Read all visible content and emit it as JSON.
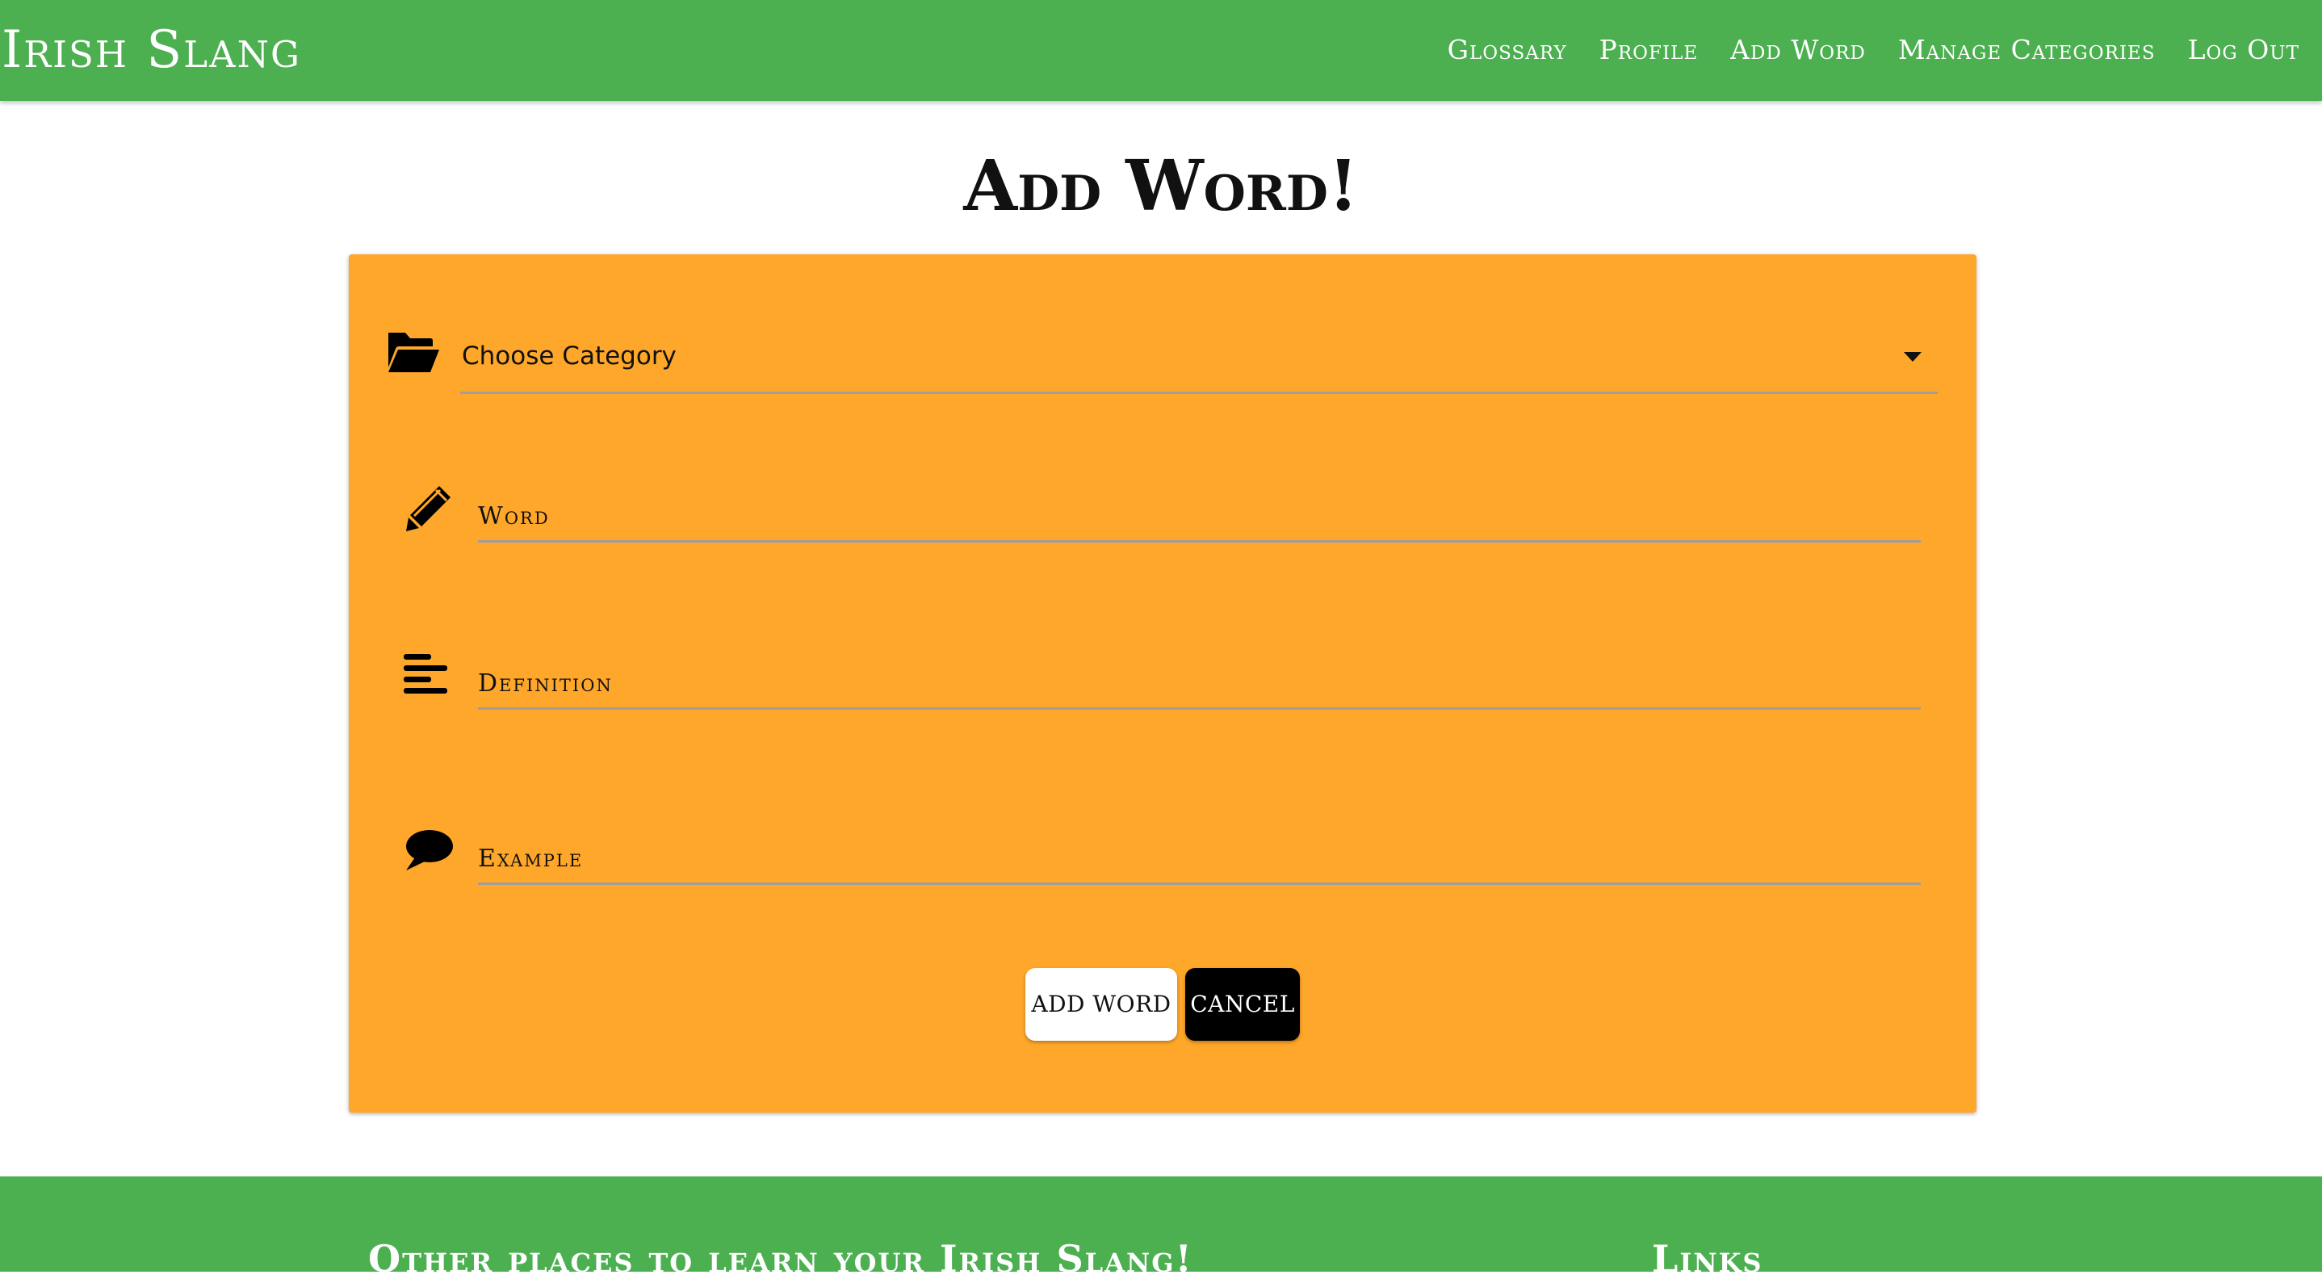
{
  "nav": {
    "brand": "Irish Slang",
    "links": [
      "Glossary",
      "Profile",
      "Add Word",
      "Manage Categories",
      "Log Out"
    ]
  },
  "page": {
    "title": "Add Word!"
  },
  "form": {
    "category": {
      "value": "Choose Category",
      "icon": "folder-open-icon"
    },
    "fields": [
      {
        "label": "Word",
        "icon": "pencil-icon"
      },
      {
        "label": "Definition",
        "icon": "align-left-icon"
      },
      {
        "label": "Example",
        "icon": "comment-icon"
      }
    ],
    "buttons": {
      "add_label": "ADD WORD",
      "cancel_label": "CANCEL"
    }
  },
  "footer": {
    "left_heading": "Other places to learn your Irish Slang!",
    "right_heading": "Links"
  },
  "colors": {
    "nav": "#4caf50",
    "card": "#ffa72a",
    "add_button": "#ffffff",
    "cancel_button": "#000000"
  }
}
